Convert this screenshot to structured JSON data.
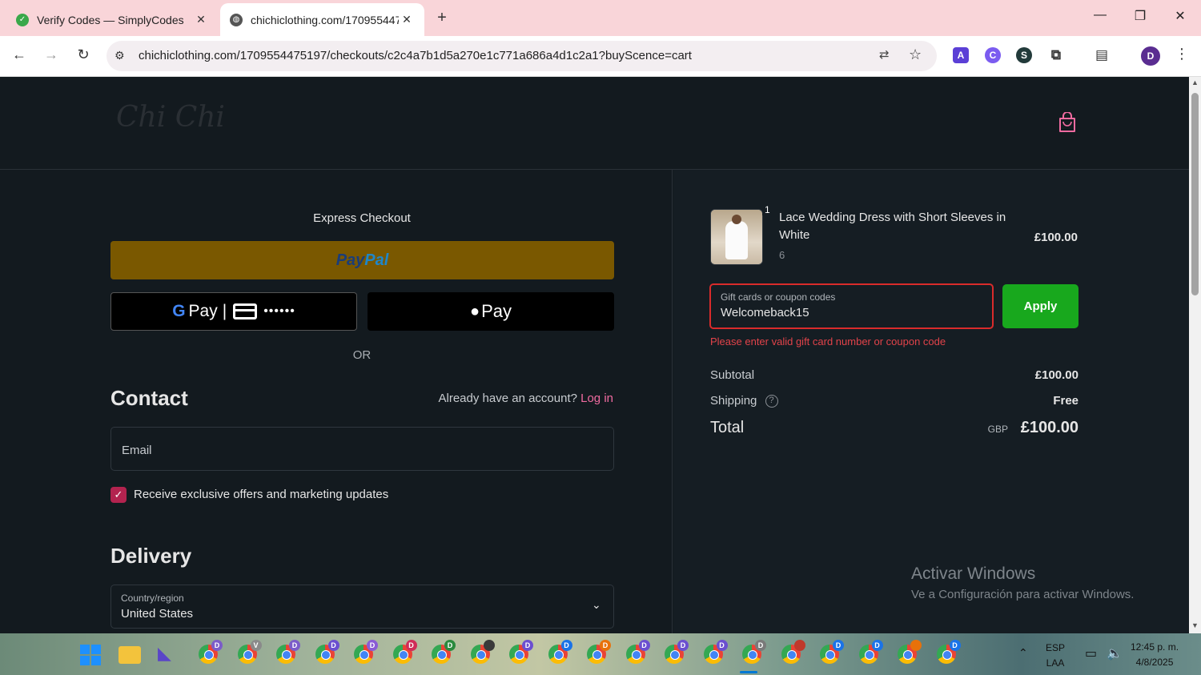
{
  "browser": {
    "tabs": [
      {
        "title": "Verify Codes — SimplyCodes",
        "active": false
      },
      {
        "title": "chichiclothing.com/170955447",
        "active": true
      }
    ],
    "url": "chichiclothing.com/1709554475197/checkouts/c2c4a7b1d5a270e1c771a686a4d1c2a1?buyScence=cart",
    "profile_initial": "D",
    "extensions": [
      "A",
      "C",
      "S",
      "puzzle"
    ]
  },
  "header": {
    "logo_text": "Chi Chi"
  },
  "express": {
    "title": "Express Checkout",
    "paypal_label_a": "Pay",
    "paypal_label_b": "Pal",
    "gpay_label": "Pay",
    "gpay_mask": "••••••",
    "applepay_label": "Pay",
    "or_label": "OR"
  },
  "contact": {
    "title": "Contact",
    "account_prompt": "Already have an account?",
    "login_label": "Log in",
    "email_placeholder": "Email",
    "marketing_label": "Receive exclusive offers and marketing updates",
    "marketing_checked": true
  },
  "delivery": {
    "title": "Delivery",
    "country_label": "Country/region",
    "country_value": "United States"
  },
  "order": {
    "item": {
      "quantity": "1",
      "name": "Lace Wedding Dress with Short Sleeves in White",
      "variant": "6",
      "price": "£100.00"
    },
    "coupon": {
      "label": "Gift cards or coupon codes",
      "value": "Welcomeback15",
      "apply_label": "Apply",
      "error": "Please enter valid gift card number or coupon code"
    },
    "subtotal_label": "Subtotal",
    "subtotal_value": "£100.00",
    "shipping_label": "Shipping",
    "shipping_value": "Free",
    "total_label": "Total",
    "total_currency": "GBP",
    "total_value": "£100.00"
  },
  "watermark": {
    "line1": "Activar Windows",
    "line2": "Ve a Configuración para activar Windows."
  },
  "taskbar": {
    "chrome_badges": [
      "D",
      "V",
      "D",
      "D",
      "D",
      "D",
      "D",
      "",
      "D",
      "D",
      "D",
      "D",
      "D",
      "D",
      "D",
      "",
      "D",
      "D",
      "",
      "D"
    ],
    "lang_top": "ESP",
    "lang_bottom": "LAA",
    "time": "12:45 p. m.",
    "date": "4/8/2025"
  },
  "colors": {
    "accent_pink": "#f06ba0",
    "error_red": "#d92b2b",
    "apply_green": "#18a81d",
    "paypal_gold": "#7a5800"
  }
}
